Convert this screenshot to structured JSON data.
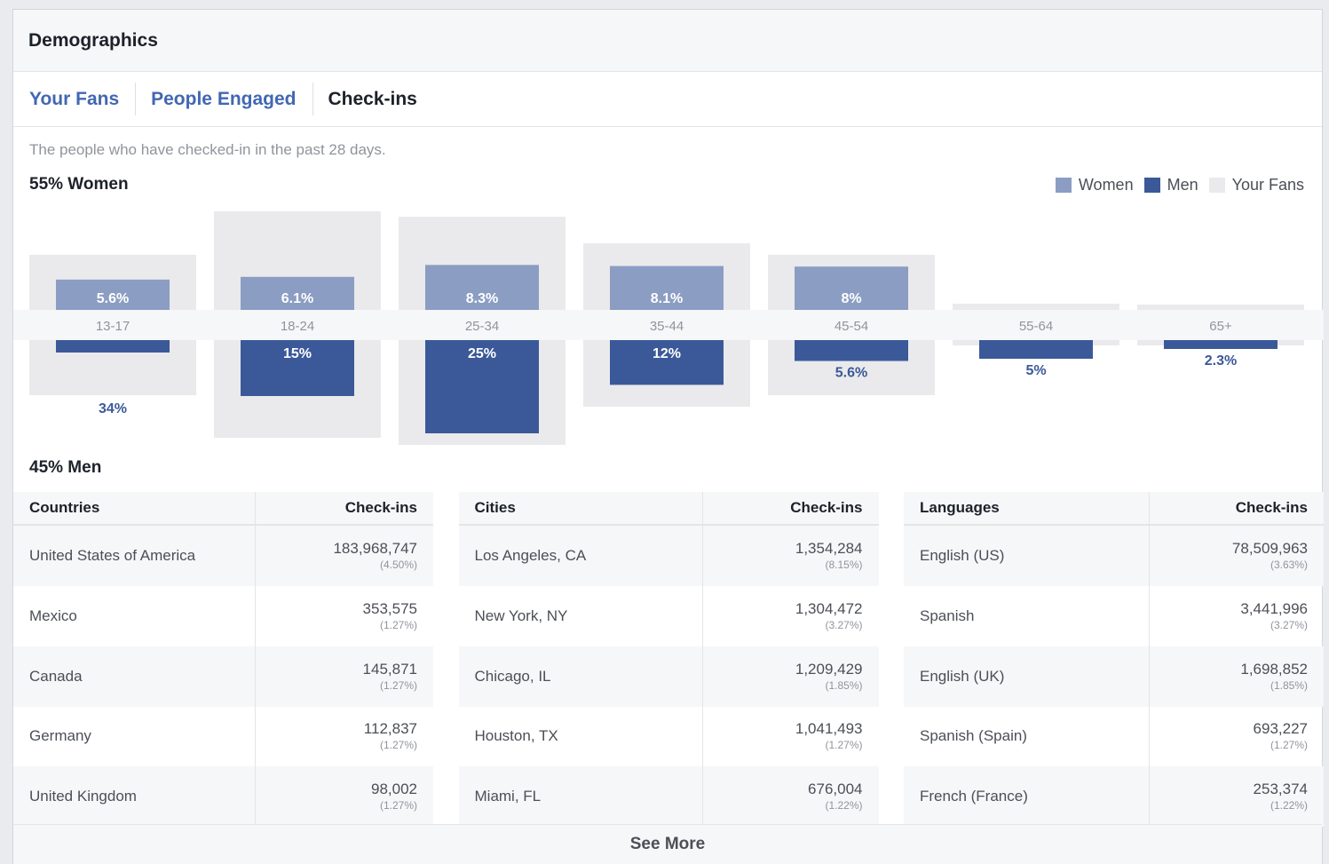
{
  "header": {
    "title": "Demographics"
  },
  "tabs": [
    {
      "label": "Your Fans",
      "active": false
    },
    {
      "label": "People Engaged",
      "active": false
    },
    {
      "label": "Check-ins",
      "active": true
    }
  ],
  "description": "The people who have checked-in in the past 28 days.",
  "summary": {
    "women": "55% Women",
    "men": "45% Men"
  },
  "legend": [
    {
      "label": "Women",
      "color": "#8b9dc3"
    },
    {
      "label": "Men",
      "color": "#3b5998"
    },
    {
      "label": "Your Fans",
      "color": "#eaeaec"
    }
  ],
  "chart_data": {
    "type": "bar",
    "categories": [
      "13-17",
      "18-24",
      "25-34",
      "35-44",
      "45-54",
      "55-64",
      "65+"
    ],
    "series": [
      {
        "name": "Women",
        "values": [
          5.6,
          6.1,
          8.3,
          8.1,
          8,
          null,
          null
        ],
        "labels": [
          "5.6%",
          "6.1%",
          "8.3%",
          "8.1%",
          "8%",
          "",
          ""
        ]
      },
      {
        "name": "Men",
        "values": [
          null,
          15,
          25,
          12,
          5.6,
          5,
          2.3
        ],
        "labels": [
          "",
          "15%",
          "25%",
          "12%",
          "5.6%",
          "5%",
          "2.3%"
        ]
      }
    ],
    "fans_men_label_13_17": "34%",
    "colors": {
      "women": "#8b9dc3",
      "men": "#3b5998",
      "fans": "#eaeaec"
    }
  },
  "tables": [
    {
      "col1": "Countries",
      "col2": "Check-ins",
      "rows": [
        {
          "name": "United States of America",
          "count": "183,968,747",
          "share": "(4.50%)"
        },
        {
          "name": "Mexico",
          "count": "353,575",
          "share": "(1.27%)"
        },
        {
          "name": "Canada",
          "count": "145,871",
          "share": "(1.27%)"
        },
        {
          "name": "Germany",
          "count": "112,837",
          "share": "(1.27%)"
        },
        {
          "name": "United Kingdom",
          "count": "98,002",
          "share": "(1.27%)"
        }
      ]
    },
    {
      "col1": "Cities",
      "col2": "Check-ins",
      "rows": [
        {
          "name": "Los Angeles, CA",
          "count": "1,354,284",
          "share": "(8.15%)"
        },
        {
          "name": "New York, NY",
          "count": "1,304,472",
          "share": "(3.27%)"
        },
        {
          "name": "Chicago, IL",
          "count": "1,209,429",
          "share": "(1.85%)"
        },
        {
          "name": "Houston, TX",
          "count": "1,041,493",
          "share": "(1.27%)"
        },
        {
          "name": "Miami, FL",
          "count": "676,004",
          "share": "(1.22%)"
        }
      ]
    },
    {
      "col1": "Languages",
      "col2": "Check-ins",
      "rows": [
        {
          "name": "English (US)",
          "count": "78,509,963",
          "share": "(3.63%)"
        },
        {
          "name": "Spanish",
          "count": "3,441,996",
          "share": "(3.27%)"
        },
        {
          "name": "English (UK)",
          "count": "1,698,852",
          "share": "(1.85%)"
        },
        {
          "name": "Spanish (Spain)",
          "count": "693,227",
          "share": "(1.27%)"
        },
        {
          "name": "French (France)",
          "count": "253,374",
          "share": "(1.22%)"
        }
      ]
    }
  ],
  "footer": {
    "see_more": "See More"
  }
}
